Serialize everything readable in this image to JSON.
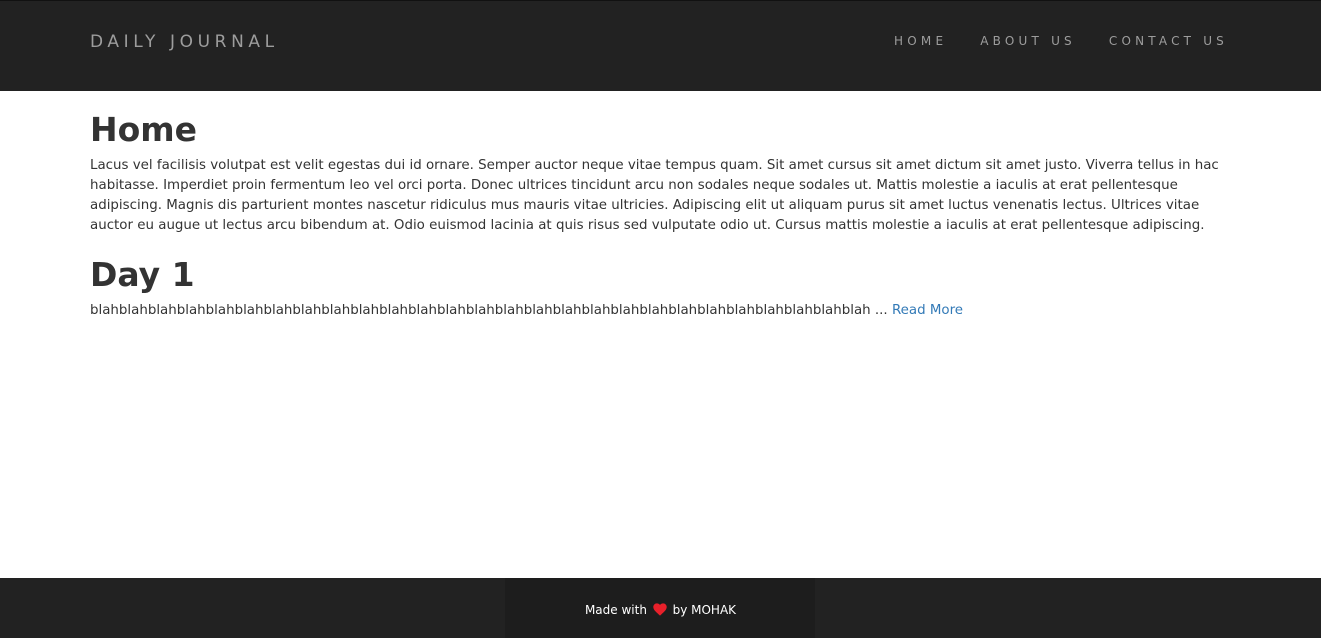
{
  "navbar": {
    "brand": "DAILY JOURNAL",
    "links": [
      {
        "label": "HOME"
      },
      {
        "label": "ABOUT US"
      },
      {
        "label": "CONTACT US"
      }
    ]
  },
  "home": {
    "title": "Home",
    "intro": "Lacus vel facilisis volutpat est velit egestas dui id ornare. Semper auctor neque vitae tempus quam. Sit amet cursus sit amet dictum sit amet justo. Viverra tellus in hac habitasse. Imperdiet proin fermentum leo vel orci porta. Donec ultrices tincidunt arcu non sodales neque sodales ut. Mattis molestie a iaculis at erat pellentesque adipiscing. Magnis dis parturient montes nascetur ridiculus mus mauris vitae ultricies. Adipiscing elit ut aliquam purus sit amet luctus venenatis lectus. Ultrices vitae auctor eu augue ut lectus arcu bibendum at. Odio euismod lacinia at quis risus sed vulputate odio ut. Cursus mattis molestie a iaculis at erat pellentesque adipiscing."
  },
  "posts": [
    {
      "title": "Day 1",
      "excerpt": "blahblahblahblahblahblahblahblahblahblahblahblahblahblahblahblahblahblahblahblahblahblahblahblahblahblahblah ...",
      "read_more": "Read More"
    }
  ],
  "footer": {
    "made_with": "Made with",
    "by": "by MOHAK",
    "icon": "heart-icon",
    "heart_color": "#e8202a"
  },
  "colors": {
    "navbar_bg": "#222222",
    "nav_text": "#9d9d9d",
    "link": "#337ab7",
    "body_text": "#333333"
  }
}
